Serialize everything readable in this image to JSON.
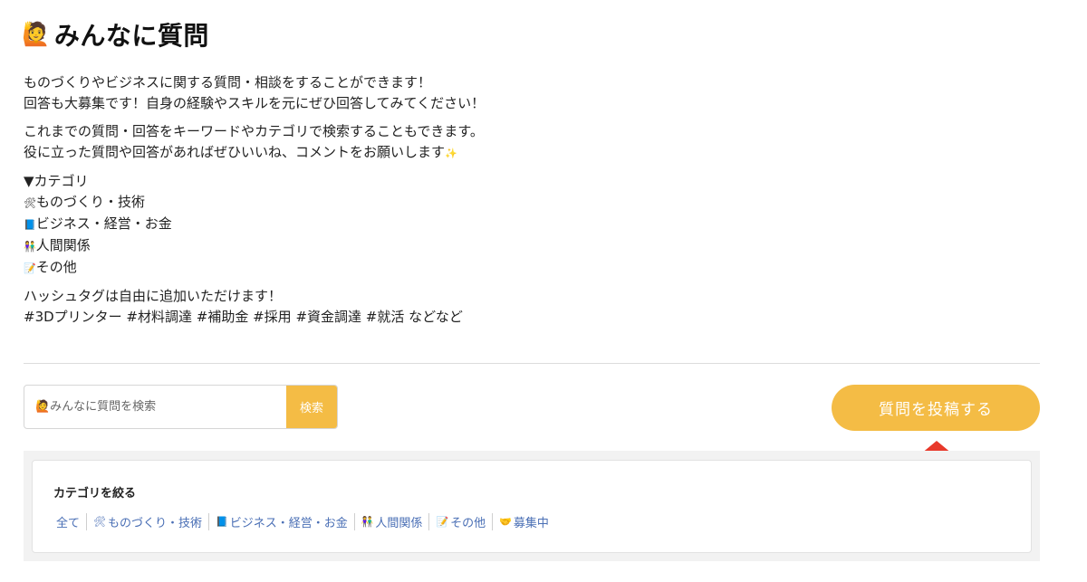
{
  "header": {
    "icon": "person-raising-hand-icon",
    "icon_glyph": "🙋",
    "title": "みんなに質問"
  },
  "intro": {
    "p1": [
      "ものづくりやビジネスに関する質問・相談をすることができます！",
      "回答も大募集です！自身の経験やスキルを元にぜひ回答してみてください！"
    ],
    "p2": [
      "これまでの質問・回答をキーワードやカテゴリで検索することもできます。",
      "役に立った質問や回答があればぜひいいね、コメントをお願いします"
    ],
    "sparkle_glyph": "✨",
    "category_heading": "▼カテゴリ",
    "categories": [
      {
        "icon": "tools-icon",
        "glyph": "🛠",
        "label": "ものづくり・技術"
      },
      {
        "icon": "book-icon",
        "glyph": "📘",
        "label": "ビジネス・経営・お金"
      },
      {
        "icon": "people-icon",
        "glyph": "👫",
        "label": "人間関係"
      },
      {
        "icon": "memo-icon",
        "glyph": "📝",
        "label": "その他"
      }
    ],
    "p4": [
      "ハッシュタグは自由に追加いただけます！",
      "#3Dプリンター #材料調達 #補助金 #採用 #資金調達 #就活 などなど"
    ]
  },
  "search": {
    "placeholder": "🙋みんなに質問を検索",
    "button_label": "検索"
  },
  "post_button_label": "質問を投稿する",
  "filter": {
    "heading": "カテゴリを絞る",
    "links": [
      {
        "icon": "",
        "glyph": "",
        "label": "全て"
      },
      {
        "icon": "tools-icon",
        "glyph": "🛠",
        "label": "ものづくり・技術"
      },
      {
        "icon": "book-icon",
        "glyph": "📘",
        "label": "ビジネス・経営・お金"
      },
      {
        "icon": "people-icon",
        "glyph": "👫",
        "label": "人間関係"
      },
      {
        "icon": "memo-icon",
        "glyph": "📝",
        "label": "その他"
      },
      {
        "icon": "handshake-icon",
        "glyph": "🤝",
        "label": "募集中"
      }
    ]
  },
  "colors": {
    "accent": "#f4bc45",
    "link": "#4a6fb5",
    "arrow": "#e8392b"
  }
}
